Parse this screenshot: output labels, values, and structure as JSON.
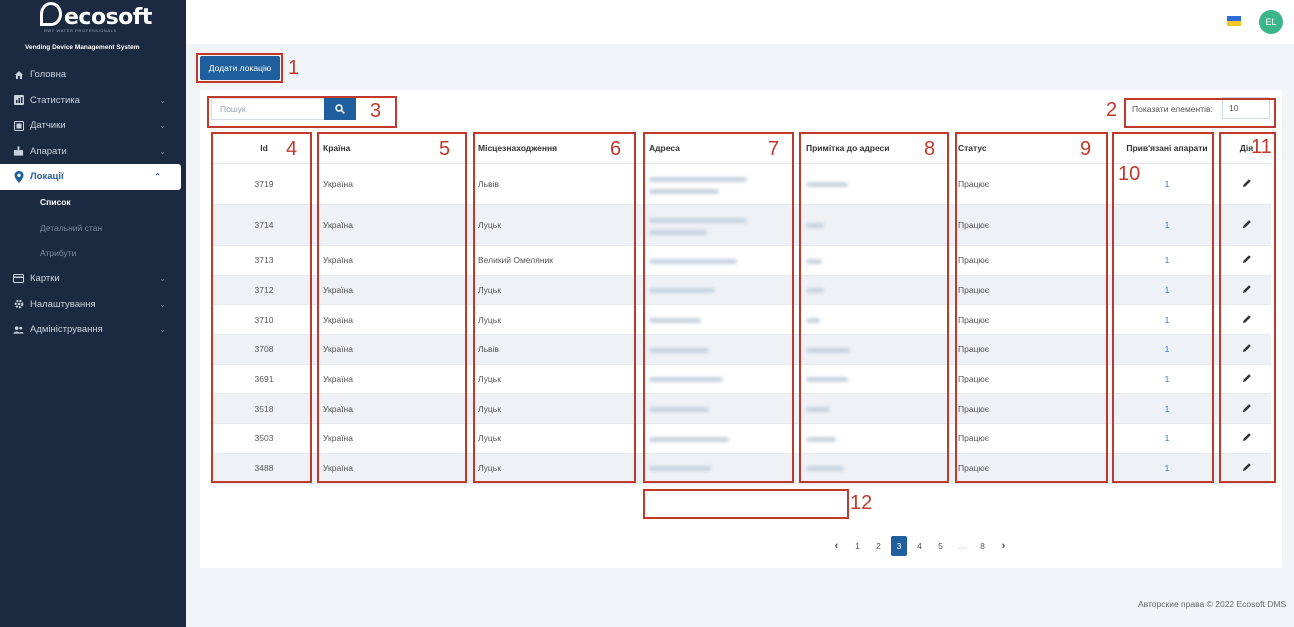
{
  "app": {
    "logo_text": "ecosoft",
    "logo_subtitle": "RWT WATER PROFESSIONALS",
    "tagline": "Vending Device Management System"
  },
  "sidebar": {
    "items": [
      {
        "label": "Головна",
        "icon": "home-icon",
        "chevron": false,
        "active": false
      },
      {
        "label": "Статистика",
        "icon": "chart-icon",
        "chevron": true,
        "active": false
      },
      {
        "label": "Датчики",
        "icon": "sensor-icon",
        "chevron": true,
        "active": false
      },
      {
        "label": "Апарати",
        "icon": "device-icon",
        "chevron": true,
        "active": false
      },
      {
        "label": "Локації",
        "icon": "location-pin-icon",
        "chevron": true,
        "active": true
      },
      {
        "label": "Картки",
        "icon": "card-icon",
        "chevron": true,
        "active": false
      },
      {
        "label": "Налаштування",
        "icon": "gear-icon",
        "chevron": true,
        "active": false
      },
      {
        "label": "Адміністрування",
        "icon": "users-icon",
        "chevron": true,
        "active": false
      }
    ],
    "subitems": [
      {
        "label": "Список",
        "current": true
      },
      {
        "label": "Детальний стан",
        "current": false
      },
      {
        "label": "Атрибути",
        "current": false
      }
    ]
  },
  "header": {
    "flag": "ukraine-flag",
    "avatar_initials": "EL"
  },
  "toolbar": {
    "add_label": "Додати локацію",
    "search_placeholder": "Пошук",
    "show_label": "Показати елементів:",
    "show_value": "10"
  },
  "table": {
    "columns": [
      "Id",
      "Країна",
      "Місцезнаходження",
      "Адреса",
      "Примітка до адреси",
      "Статус",
      "Прив'язані апарати",
      "Дія"
    ],
    "rows": [
      {
        "id": "3719",
        "country": "Україна",
        "city": "Львів",
        "status": "Працює",
        "linked": "1"
      },
      {
        "id": "3714",
        "country": "Україна",
        "city": "Луцьк",
        "status": "Працює",
        "linked": "1"
      },
      {
        "id": "3713",
        "country": "Україна",
        "city": "Великий Омеляник",
        "status": "Працює",
        "linked": "1"
      },
      {
        "id": "3712",
        "country": "Україна",
        "city": "Луцьк",
        "status": "Працює",
        "linked": "1"
      },
      {
        "id": "3710",
        "country": "Україна",
        "city": "Луцьк",
        "status": "Працює",
        "linked": "1"
      },
      {
        "id": "3708",
        "country": "Україна",
        "city": "Львів",
        "status": "Працює",
        "linked": "1"
      },
      {
        "id": "3691",
        "country": "Україна",
        "city": "Луцьк",
        "status": "Працює",
        "linked": "1"
      },
      {
        "id": "3518",
        "country": "Україна",
        "city": "Луцьк",
        "status": "Працює",
        "linked": "1"
      },
      {
        "id": "3503",
        "country": "Україна",
        "city": "Луцьк",
        "status": "Працює",
        "linked": "1"
      },
      {
        "id": "3488",
        "country": "Україна",
        "city": "Луцьк",
        "status": "Працює",
        "linked": "1"
      }
    ]
  },
  "pagination": {
    "prev": "‹",
    "pages": [
      "1",
      "2",
      "3",
      "4",
      "5",
      "...",
      "8"
    ],
    "current": "3",
    "next": "›"
  },
  "footer": {
    "text": "Авторские права © 2022 Ecosoft DMS"
  },
  "markers": [
    "1",
    "2",
    "3",
    "4",
    "5",
    "6",
    "7",
    "8",
    "9",
    "10",
    "11",
    "12"
  ],
  "colors": {
    "sidebar": "#1b2a41",
    "accent": "#1f5f9e",
    "marker": "#c0392b",
    "link": "#2d78c8"
  }
}
